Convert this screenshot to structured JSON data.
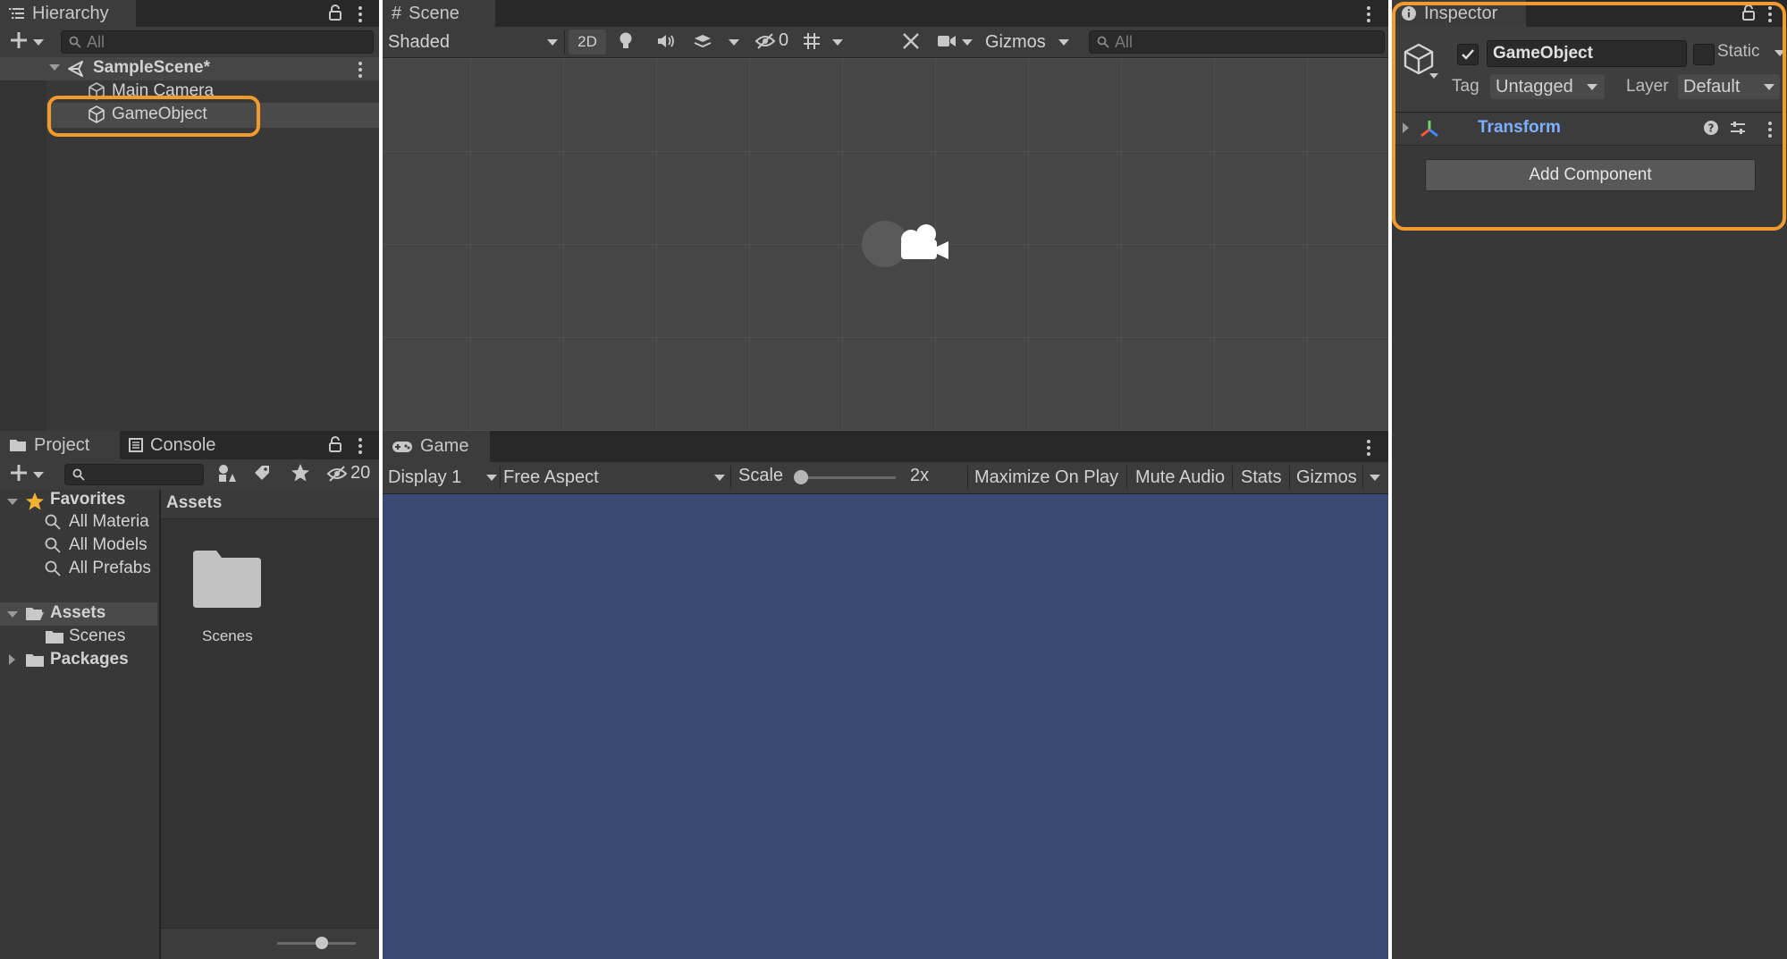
{
  "hierarchy": {
    "tab_label": "Hierarchy",
    "search_placeholder": "All",
    "scene_name": "SampleScene*",
    "items": [
      {
        "label": "Main Camera"
      },
      {
        "label": "GameObject"
      }
    ]
  },
  "scene": {
    "tab_label": "Scene",
    "shading_mode": "Shaded",
    "mode_2d": "2D",
    "hidden_count": "0",
    "gizmos_label": "Gizmos",
    "search_placeholder": "All"
  },
  "project": {
    "tabs": [
      {
        "label": "Project"
      },
      {
        "label": "Console"
      }
    ],
    "hidden_count": "20",
    "favorites_label": "Favorites",
    "favorites": [
      {
        "label": "All Materia"
      },
      {
        "label": "All Models"
      },
      {
        "label": "All Prefabs"
      }
    ],
    "assets_label": "Assets",
    "assets_children": [
      {
        "label": "Scenes"
      }
    ],
    "packages_label": "Packages",
    "breadcrumb": "Assets",
    "folders": [
      {
        "label": "Scenes"
      }
    ]
  },
  "game": {
    "tab_label": "Game",
    "display": "Display 1",
    "aspect": "Free Aspect",
    "scale_label": "Scale",
    "scale_value": "2x",
    "maximize_label": "Maximize On Play",
    "mute_label": "Mute Audio",
    "stats_label": "Stats",
    "gizmos_label": "Gizmos",
    "background_color": "#384a75"
  },
  "inspector": {
    "tab_label": "Inspector",
    "object_name": "GameObject",
    "static_label": "Static",
    "tag_label": "Tag",
    "tag_value": "Untagged",
    "layer_label": "Layer",
    "layer_value": "Default",
    "component_name": "Transform",
    "add_component_label": "Add Component"
  },
  "colors": {
    "highlight": "#f29a2e",
    "panel_bg": "#383838",
    "toolbar_bg": "#3c3c3c",
    "tab_bar_bg": "#282828",
    "transform_label": "#7cb0ff"
  }
}
